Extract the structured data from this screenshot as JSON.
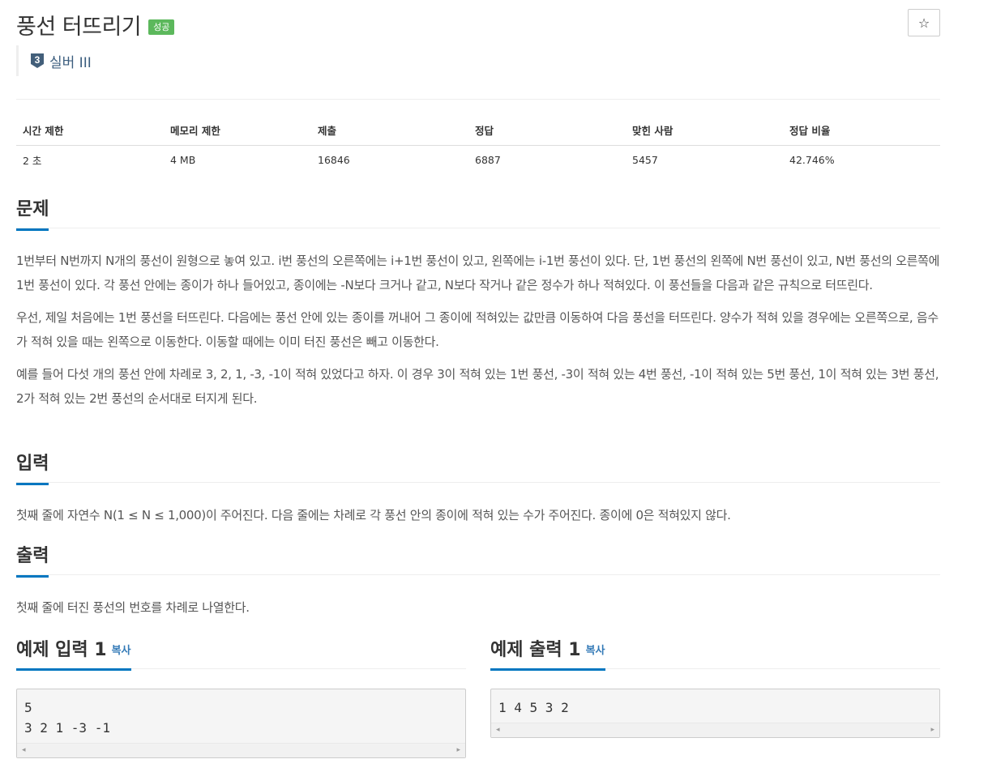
{
  "problem": {
    "title": "풍선 터뜨리기",
    "status_badge": "성공",
    "tier_number": "3",
    "tier_label": "실버 III",
    "star_icon": "☆"
  },
  "info_table": {
    "headers": [
      "시간 제한",
      "메모리 제한",
      "제출",
      "정답",
      "맞힌 사람",
      "정답 비율"
    ],
    "values": [
      "2 초",
      "4 MB",
      "16846",
      "6887",
      "5457",
      "42.746%"
    ]
  },
  "sections": {
    "description": {
      "title": "문제",
      "paragraphs": [
        "1번부터 N번까지 N개의 풍선이 원형으로 놓여 있고. i번 풍선의 오른쪽에는 i+1번 풍선이 있고, 왼쪽에는 i-1번 풍선이 있다. 단, 1번 풍선의 왼쪽에 N번 풍선이 있고, N번 풍선의 오른쪽에 1번 풍선이 있다. 각 풍선 안에는 종이가 하나 들어있고, 종이에는 -N보다 크거나 같고, N보다 작거나 같은 정수가 하나 적혀있다. 이 풍선들을 다음과 같은 규칙으로 터뜨린다.",
        "우선, 제일 처음에는 1번 풍선을 터뜨린다. 다음에는 풍선 안에 있는 종이를 꺼내어 그 종이에 적혀있는 값만큼 이동하여 다음 풍선을 터뜨린다. 양수가 적혀 있을 경우에는 오른쪽으로, 음수가 적혀 있을 때는 왼쪽으로 이동한다. 이동할 때에는 이미 터진 풍선은 빼고 이동한다.",
        "예를 들어 다섯 개의 풍선 안에 차례로 3, 2, 1, -3, -1이 적혀 있었다고 하자. 이 경우 3이 적혀 있는 1번 풍선, -3이 적혀 있는 4번 풍선, -1이 적혀 있는 5번 풍선, 1이 적혀 있는 3번 풍선, 2가 적혀 있는 2번 풍선의 순서대로 터지게 된다."
      ]
    },
    "input": {
      "title": "입력",
      "text": "첫째 줄에 자연수 N(1 ≤ N ≤ 1,000)이 주어진다. 다음 줄에는 차례로 각 풍선 안의 종이에 적혀 있는 수가 주어진다. 종이에 0은 적혀있지 않다."
    },
    "output": {
      "title": "출력",
      "text": "첫째 줄에 터진 풍선의 번호를 차례로 나열한다."
    }
  },
  "samples": {
    "input": {
      "title": "예제 입력 1",
      "copy_label": "복사",
      "content": "5\n3 2 1 -3 -1"
    },
    "output": {
      "title": "예제 출력 1",
      "copy_label": "복사",
      "content": "1 4 5 3 2"
    }
  },
  "colors": {
    "success_badge": "#5cb85c",
    "section_underline": "#0076c0",
    "tier_silver": "#435f7a",
    "link": "#337ab7"
  }
}
